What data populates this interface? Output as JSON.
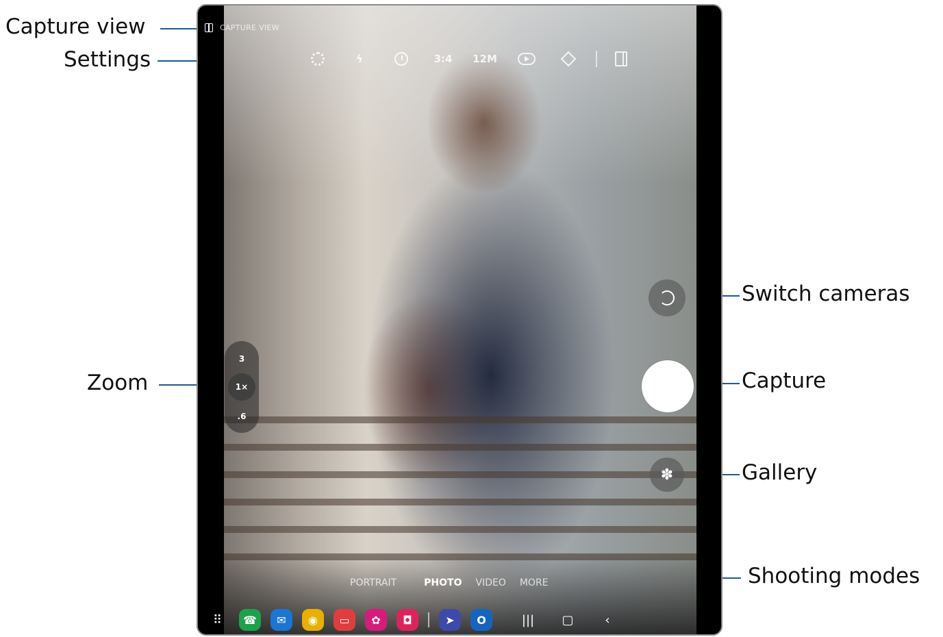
{
  "callouts": {
    "capture_view": "Capture view",
    "settings": "Settings",
    "zoom": "Zoom",
    "switch_cameras": "Switch cameras",
    "capture": "Capture",
    "gallery": "Gallery",
    "shooting_modes": "Shooting modes"
  },
  "callout_line_color": "#1e5b8f",
  "top_bar": {
    "capture_view_label": "CAPTURE VIEW",
    "icons": [
      "settings-icon",
      "flash-off-icon",
      "timer-icon",
      "motion-photo-icon",
      "filters-icon",
      "cover-screen-icon"
    ],
    "aspect_ratio": "3:4",
    "resolution": "12M"
  },
  "zoom": {
    "levels": [
      "3",
      "1×",
      ".6"
    ],
    "selected": "1×"
  },
  "controls": {
    "switch_icon": "switch-camera-icon",
    "gallery_icon": "gallery-flower-icon"
  },
  "modes": {
    "items": [
      "PORTRAIT",
      "PHOTO",
      "VIDEO",
      "MORE"
    ],
    "active": "PHOTO"
  },
  "dock": {
    "apps": [
      {
        "name": "phone-icon",
        "color": "#1aa34a",
        "glyph": "☎"
      },
      {
        "name": "messages-icon",
        "color": "#1976d2",
        "glyph": "✉"
      },
      {
        "name": "chrome-icon",
        "color": "#e8b100",
        "glyph": "◉"
      },
      {
        "name": "notes-icon",
        "color": "#e23d3d",
        "glyph": "▭"
      },
      {
        "name": "gallery-app-icon",
        "color": "#d81b7a",
        "glyph": "✿"
      },
      {
        "name": "camera-app-icon",
        "color": "#e0225a",
        "glyph": "◘"
      },
      {
        "name": "compass-icon",
        "color": "#3d4aa8",
        "glyph": "➤"
      },
      {
        "name": "outlook-icon",
        "color": "#1565c0",
        "glyph": "O"
      }
    ],
    "nav": [
      "recents-icon",
      "home-icon",
      "back-icon"
    ]
  }
}
